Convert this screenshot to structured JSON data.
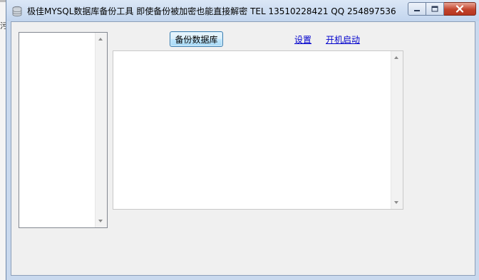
{
  "window": {
    "title": "极佳MYSQL数据库备份工具 即使备份被加密也能直接解密 TEL 13510228421 QQ 254897536",
    "controls": [
      "minimize-icon",
      "maximize-icon",
      "close-icon"
    ],
    "app_icon": "database-icon"
  },
  "desktop": {
    "edge_glyph": "污"
  },
  "toolbar": {
    "backup_button": "备份数据库",
    "settings_link": "设置",
    "autostart_link": "开机启动"
  },
  "database_list": {
    "items": []
  },
  "log": {
    "text": ""
  },
  "colors": {
    "titlebar": "#c9d9ee",
    "client_bg": "#f0f0f0",
    "link": "#0000cc",
    "close_button": "#c2432c"
  }
}
